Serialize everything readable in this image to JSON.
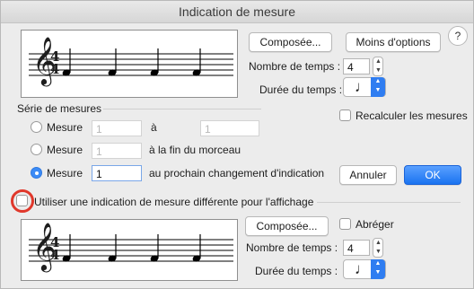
{
  "window": {
    "title": "Indication de mesure"
  },
  "buttons": {
    "composee": "Composée...",
    "more_options": "Moins d'options",
    "cancel": "Annuler",
    "ok": "OK",
    "help": "?"
  },
  "top": {
    "beats_label": "Nombre de temps :",
    "beats_value": "4",
    "duration_label": "Durée du temps :",
    "note_symbol": "♩"
  },
  "series": {
    "heading": "Série de mesures",
    "recalc_label": "Recalculer les mesures",
    "options": [
      {
        "label": "Mesure",
        "value": "1",
        "middle": "à",
        "end_value": "1",
        "selected": false
      },
      {
        "label": "Mesure",
        "value": "1",
        "after": "à la fin du morceau",
        "selected": false
      },
      {
        "label": "Mesure",
        "value": "1",
        "after": "au prochain changement d'indication",
        "selected": true
      }
    ]
  },
  "display": {
    "checkbox_label": "Utiliser une indication de mesure différente pour l'affichage",
    "composee": "Composée...",
    "abbreviate_label": "Abréger",
    "beats_label": "Nombre de temps :",
    "beats_value": "4",
    "duration_label": "Durée du temps :",
    "note_symbol": "♩"
  },
  "staff": {
    "clef": "𝄞",
    "time_top": "4",
    "time_bottom": "4",
    "notes_count": 4
  },
  "colors": {
    "accent": "#2f7df1",
    "highlight_ring": "#e0382b"
  }
}
